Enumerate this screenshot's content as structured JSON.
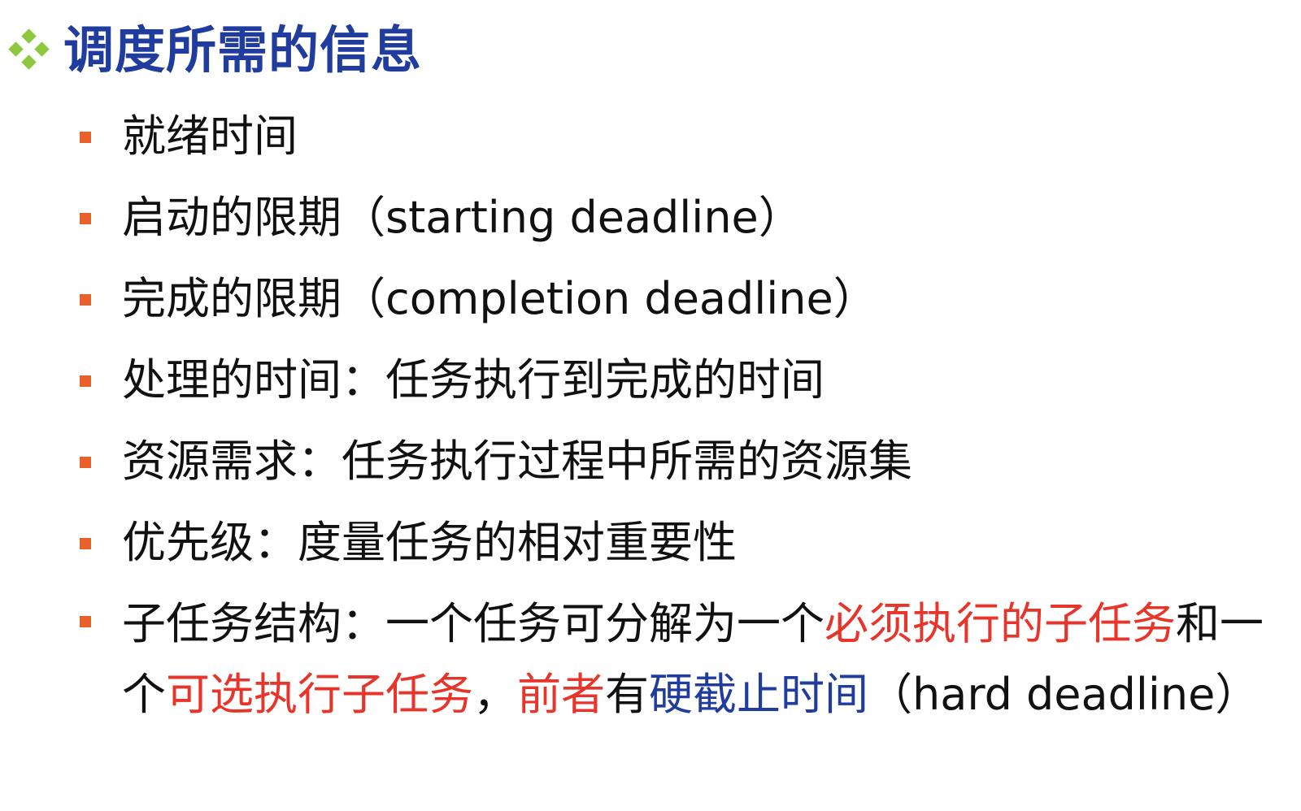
{
  "slide": {
    "title": "调度所需的信息",
    "title_color": "#1f3c9e",
    "title_icon": "four-diamond-icon",
    "accent_icon_color": "#8dc63f",
    "bullet_color": "#e8612c",
    "highlight_red": "#e8352b",
    "highlight_blue": "#1f3c9e",
    "items": [
      {
        "text": "就绪时间"
      },
      {
        "text": "启动的限期（starting deadline）"
      },
      {
        "text": "完成的限期（completion deadline）"
      },
      {
        "text": "处理的时间：任务执行到完成的时间"
      },
      {
        "text": "资源需求：任务执行过程中所需的资源集"
      },
      {
        "text": "优先级：度量任务的相对重要性"
      },
      {
        "segments": [
          {
            "text": "子任务结构：一个任务可分解为一个",
            "style": "normal"
          },
          {
            "text": "必须执行的子任务",
            "style": "red"
          },
          {
            "text": "和一个",
            "style": "normal"
          },
          {
            "text": "可选执行子任务",
            "style": "red"
          },
          {
            "text": "，",
            "style": "normal"
          },
          {
            "text": "前者",
            "style": "red"
          },
          {
            "text": "有",
            "style": "normal"
          },
          {
            "text": "硬截止时间",
            "style": "blue"
          },
          {
            "text": "（hard deadline）",
            "style": "normal"
          }
        ]
      }
    ]
  }
}
